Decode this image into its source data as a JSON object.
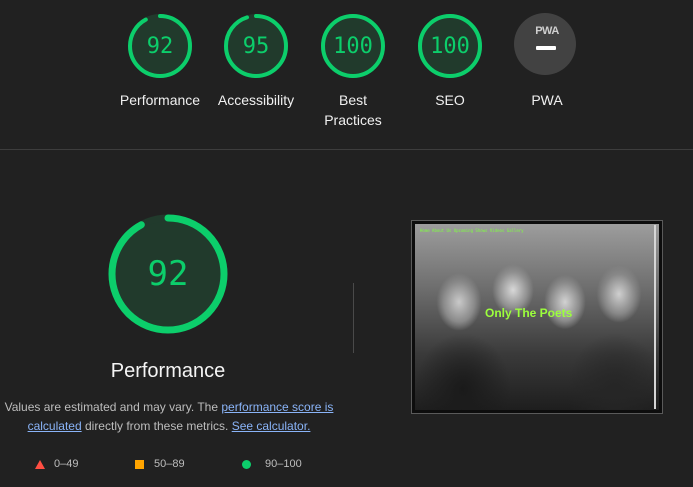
{
  "categories": [
    {
      "label": "Performance",
      "score": "92",
      "fraction": 0.92
    },
    {
      "label": "Accessibility",
      "score": "95",
      "fraction": 0.95
    },
    {
      "label": "Best Practices",
      "score": "100",
      "fraction": 1.0
    },
    {
      "label": "SEO",
      "score": "100",
      "fraction": 1.0
    },
    {
      "label": "PWA",
      "badge": "PWA"
    }
  ],
  "detail": {
    "score": "92",
    "fraction": 0.92,
    "title": "Performance",
    "note_prefix": "Values are estimated and may vary. The ",
    "note_link1": "performance score is calculated",
    "note_mid": " directly from these metrics. ",
    "note_link2": "See calculator."
  },
  "legend": [
    {
      "range": "0–49",
      "shape": "triangle",
      "color": "#ff4e42"
    },
    {
      "range": "50–89",
      "shape": "square",
      "color": "#ffa400"
    },
    {
      "range": "90–100",
      "shape": "circle",
      "color": "#0cce6b"
    }
  ],
  "screenshot": {
    "overlay_text": "Only The Poets",
    "header_text": "Home About Us Upcoming Shows Videos Gallery"
  },
  "colors": {
    "pass": "#0cce6b",
    "pass_bg": "#213a2c",
    "background": "#212121",
    "link": "#8ab4f8"
  }
}
